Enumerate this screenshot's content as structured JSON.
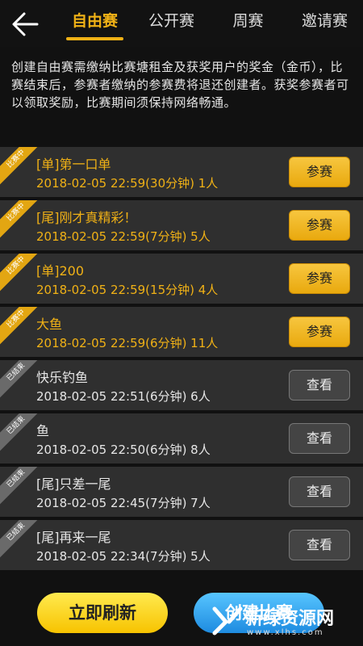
{
  "header": {
    "back_icon": "arrow-left-icon",
    "tabs": [
      {
        "label": "自由赛",
        "active": true
      },
      {
        "label": "公开赛",
        "active": false
      },
      {
        "label": "周赛",
        "active": false
      },
      {
        "label": "邀请赛",
        "active": false
      }
    ]
  },
  "notice": "创建自由赛需缴纳比赛塘租金及获奖用户的奖金（金币），比赛结束后，参赛者缴纳的参赛费将退还创建者。获奖参赛者可以领取奖励，比赛期间须保持网络畅通。",
  "matches": [
    {
      "status_label": "比赛中",
      "title": "[单]第一口单",
      "meta": "2018-02-05 22:59(30分钟) 1人",
      "button": "参赛",
      "state": "ongoing"
    },
    {
      "status_label": "比赛中",
      "title": "[尾]刚才真精彩！",
      "meta": "2018-02-05 22:59(7分钟) 5人",
      "button": "参赛",
      "state": "ongoing"
    },
    {
      "status_label": "比赛中",
      "title": "[单]200",
      "meta": "2018-02-05 22:59(15分钟) 4人",
      "button": "参赛",
      "state": "ongoing"
    },
    {
      "status_label": "比赛中",
      "title": "大鱼",
      "meta": "2018-02-05 22:59(6分钟) 11人",
      "button": "参赛",
      "state": "ongoing"
    },
    {
      "status_label": "已结束",
      "title": "快乐钓鱼",
      "meta": "2018-02-05 22:51(6分钟) 6人",
      "button": "查看",
      "state": "ended"
    },
    {
      "status_label": "已结束",
      "title": "鱼",
      "meta": "2018-02-05 22:50(6分钟) 8人",
      "button": "查看",
      "state": "ended"
    },
    {
      "status_label": "已结束",
      "title": "[尾]只差一尾",
      "meta": "2018-02-05 22:45(7分钟) 7人",
      "button": "查看",
      "state": "ended"
    },
    {
      "status_label": "已结束",
      "title": "[尾]再来一尾",
      "meta": "2018-02-05 22:34(7分钟) 5人",
      "button": "查看",
      "state": "ended"
    }
  ],
  "bottom": {
    "refresh_label": "立即刷新",
    "create_label": "创建比赛"
  },
  "watermark": {
    "brand": "新绿资源网",
    "url": "www.xlhs.com"
  },
  "colors": {
    "accent": "#f0b116",
    "background": "#111111",
    "row_bg": "#2f2f2f"
  }
}
